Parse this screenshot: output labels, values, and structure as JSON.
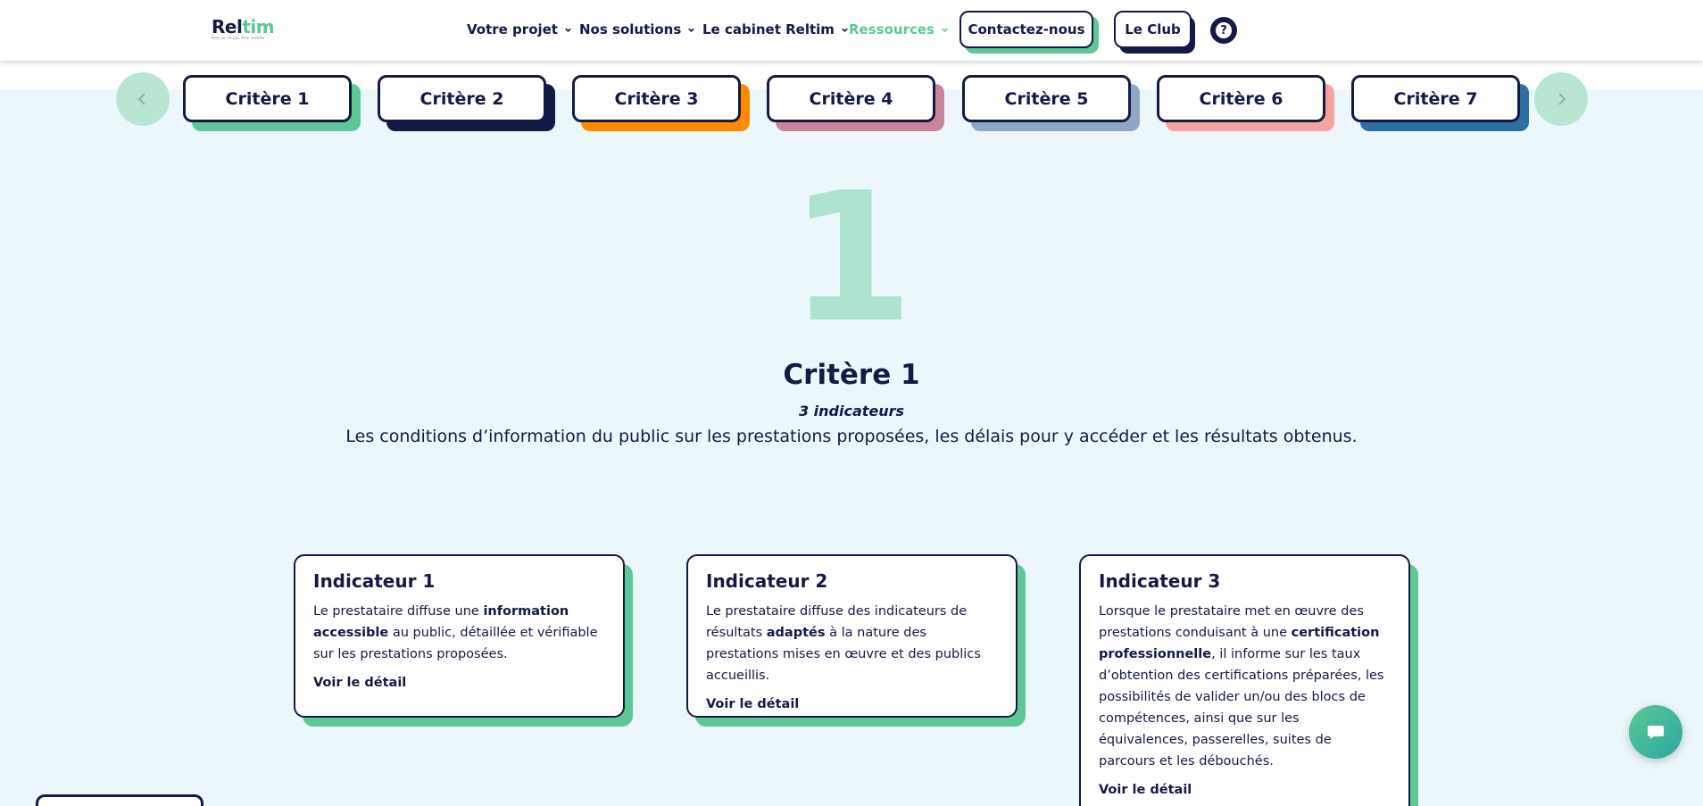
{
  "logo": {
    "part1": "Rel",
    "part2": "tim",
    "tagline": "Être ou ne pas être certifié"
  },
  "nav": {
    "items": [
      {
        "label": "Votre projet"
      },
      {
        "label": "Nos solutions"
      },
      {
        "label": "Le cabinet Reltim"
      },
      {
        "label": "Ressources"
      }
    ],
    "contact_label": "Contactez-nous",
    "club_label": "Le Club",
    "help_label": "?"
  },
  "tabs": [
    {
      "label": "Critère 1",
      "color": "#5cc896"
    },
    {
      "label": "Critère 2",
      "color": "#141a45"
    },
    {
      "label": "Critère 3",
      "color": "#ff8a00"
    },
    {
      "label": "Critère 4",
      "color": "#c9869a"
    },
    {
      "label": "Critère 5",
      "color": "#8fa7c4"
    },
    {
      "label": "Critère 6",
      "color": "#f6a39c"
    },
    {
      "label": "Critère 7",
      "color": "#2b6fa5"
    }
  ],
  "criterion": {
    "number": "1",
    "title": "Critère 1",
    "indicator_count": "3 indicateurs",
    "description": "Les conditions d’information du public sur les prestations proposées, les délais pour y accéder et les résultats obtenus."
  },
  "cards": [
    {
      "title": "Indicateur 1",
      "text_parts": [
        "Le prestataire diffuse une ",
        "information accessible",
        " au public, détaillée et vérifiable sur les prestations proposées."
      ],
      "link": "Voir le détail"
    },
    {
      "title": "Indicateur 2",
      "text_parts": [
        "Le prestataire diffuse des indicateurs de résultats ",
        "adaptés",
        " à la nature des prestations mises en œuvre et des publics accueillis."
      ],
      "link": "Voir le détail"
    },
    {
      "title": "Indicateur 3",
      "text_parts": [
        "Lorsque le prestataire met en œuvre des prestations conduisant à une ",
        "certification professionnelle",
        ", il informe sur les taux d’obtention des certifications préparées, les possibilités de valider un/ou des blocs de compétences, ainsi que sur les équivalences, passerelles, suites de parcours et les débouchés."
      ],
      "link": "Voir le détail"
    }
  ],
  "colors": {
    "navy": "#141a45",
    "green": "#5cc896",
    "big_number": "#aee3d0",
    "page_bg": "#ecf7fc"
  }
}
